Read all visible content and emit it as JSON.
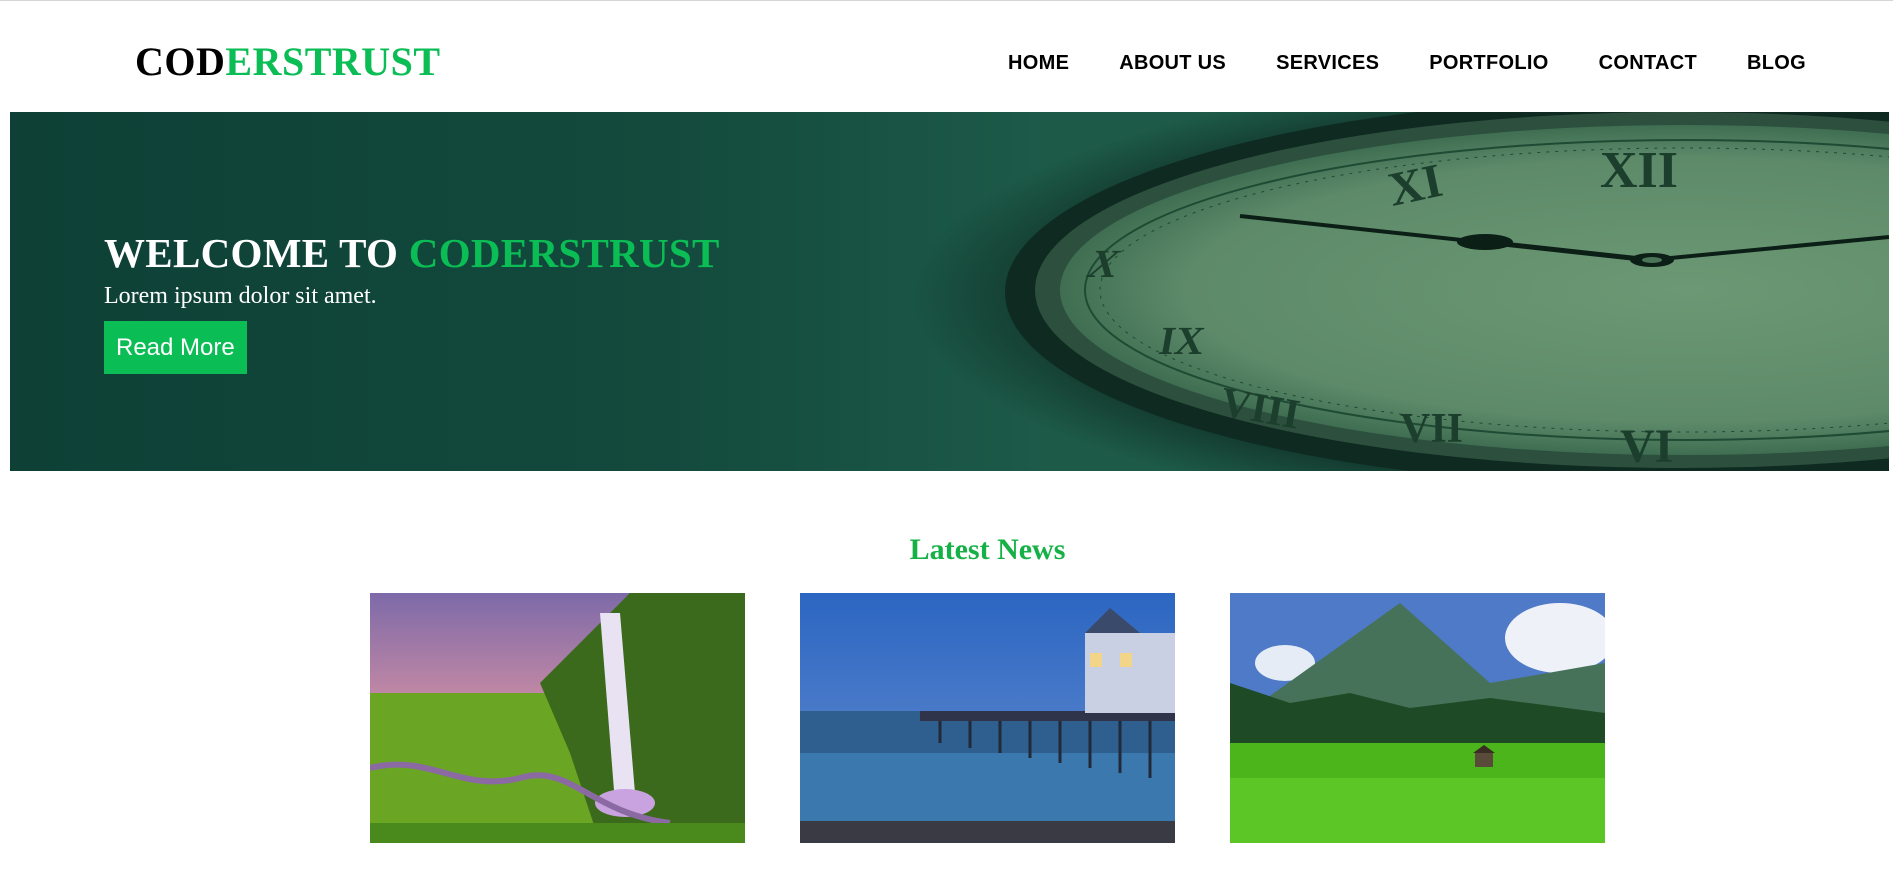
{
  "header": {
    "logo_part1": "COD",
    "logo_part2": "ERSTRUST",
    "nav": [
      "HOME",
      "ABOUT US",
      "SERVICES",
      "PORTFOLIO",
      "CONTACT",
      "BLOG"
    ]
  },
  "hero": {
    "title_prefix": "WELCOME TO ",
    "title_accent": "CODERSTRUST",
    "subtitle": "Lorem ipsum dolor sit amet.",
    "button_label": "Read More"
  },
  "news": {
    "title": "Latest News",
    "cards": [
      {
        "image": "waterfall-landscape-photo"
      },
      {
        "image": "pier-seaside-photo"
      },
      {
        "image": "mountain-meadow-photo"
      }
    ]
  },
  "colors": {
    "accent": "#0bbd55",
    "hero_bg": "#134a3d",
    "news_title": "#16b146"
  }
}
